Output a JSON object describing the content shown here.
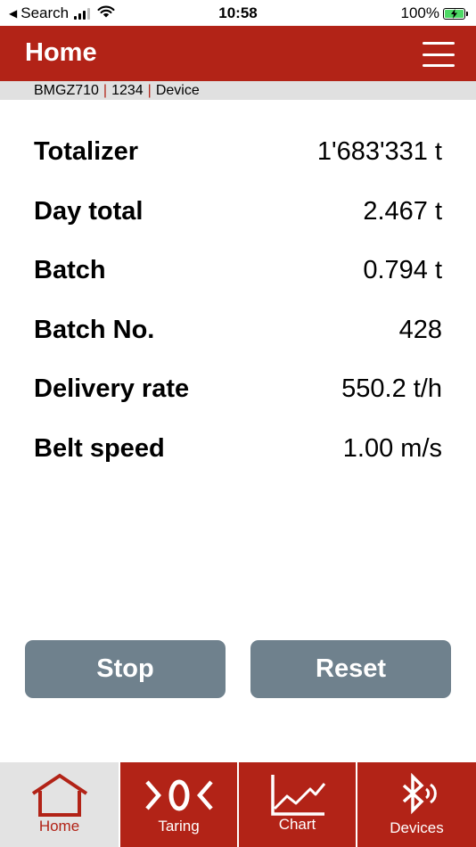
{
  "status_bar": {
    "back_label": "Search",
    "time": "10:58",
    "battery_percent": "100%"
  },
  "header": {
    "title": "Home"
  },
  "device_bar": {
    "model": "BMGZ710",
    "id": "1234",
    "name": "Device"
  },
  "measurements": [
    {
      "label": "Totalizer",
      "value": "1'683'331 t"
    },
    {
      "label": "Day total",
      "value": "2.467 t"
    },
    {
      "label": "Batch",
      "value": "0.794 t"
    },
    {
      "label": "Batch No.",
      "value": "428"
    },
    {
      "label": "Delivery rate",
      "value": "550.2 t/h"
    },
    {
      "label": "Belt speed",
      "value": "1.00 m/s"
    }
  ],
  "buttons": {
    "stop": "Stop",
    "reset": "Reset"
  },
  "tabs": [
    {
      "label": "Home",
      "icon": "home-icon",
      "active": true
    },
    {
      "label": "Taring",
      "icon": "taring-icon",
      "active": false
    },
    {
      "label": "Chart",
      "icon": "chart-icon",
      "active": false
    },
    {
      "label": "Devices",
      "icon": "bluetooth-icon",
      "active": false
    }
  ],
  "colors": {
    "brand_red": "#b22317",
    "button_gray": "#6f818d",
    "device_bar_bg": "#e0e0e0",
    "active_tab_bg": "#e3e3e3"
  }
}
